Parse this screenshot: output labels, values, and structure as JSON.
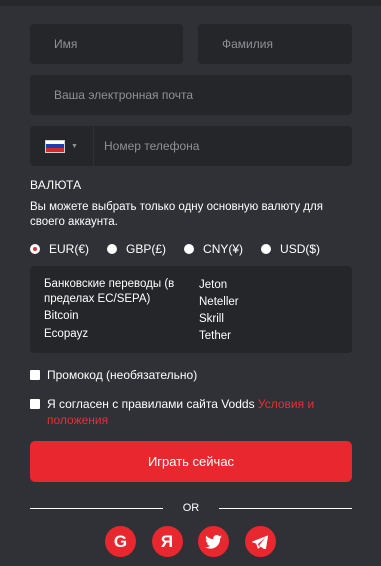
{
  "form": {
    "first_name_placeholder": "Имя",
    "last_name_placeholder": "Фамилия",
    "email_placeholder": "Ваша электронная почта",
    "phone_placeholder": "Номер телефона",
    "flag_colors": [
      "#ffffff",
      "#1c3fa8",
      "#d52b1e"
    ]
  },
  "currency": {
    "title": "ВАЛЮТА",
    "note": "Вы можете выбрать только одну основную валюту для своего аккаунта.",
    "options": [
      "EUR(€)",
      "GBP(£)",
      "CNY(¥)",
      "USD($)"
    ],
    "selected": "EUR(€)"
  },
  "methods": {
    "col1": [
      "Банковские переводы (в пределах ЕС/SEPA)",
      "Bitcoin",
      "Ecopayz"
    ],
    "col2": [
      "Jeton",
      "Neteller",
      "Skrill",
      "Tether"
    ]
  },
  "promo_label": "Промокод (необязательно)",
  "terms": {
    "text": "Я согласен с правилами сайта Vodds ",
    "link": "Условия и положения"
  },
  "cta_label": "Играть сейчас",
  "divider_text": "OR",
  "social": [
    {
      "icon": "google-icon",
      "glyph": "G"
    },
    {
      "icon": "yandex-icon",
      "glyph": "Я"
    },
    {
      "icon": "twitter-icon",
      "glyph": "twitter"
    },
    {
      "icon": "telegram-icon",
      "glyph": "telegram"
    }
  ],
  "colors": {
    "accent": "#e8282e",
    "field_bg": "#24262a",
    "page_bg": "#2f3136"
  }
}
